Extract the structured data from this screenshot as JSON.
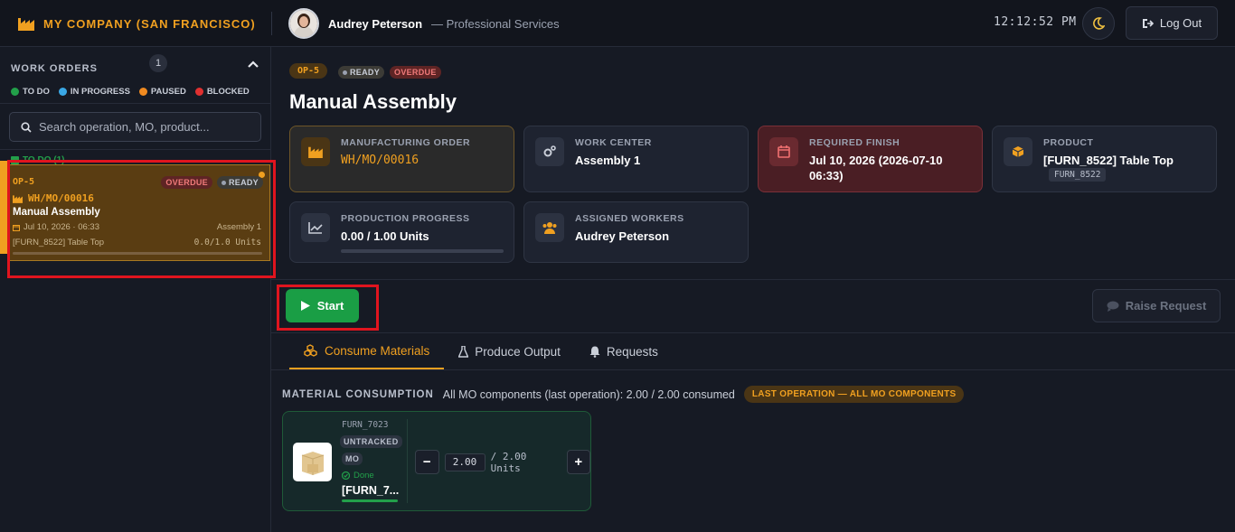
{
  "header": {
    "company": "MY COMPANY (SAN FRANCISCO)",
    "user_name": "Audrey Peterson",
    "user_dept": "— Professional Services",
    "clock": "12:12:52 PM",
    "logout_label": "Log Out"
  },
  "sidebar": {
    "title": "WORK ORDERS",
    "count": "1",
    "legend": [
      {
        "label": "TO DO",
        "color": "#22a04a"
      },
      {
        "label": "IN PROGRESS",
        "color": "#3aa8e6"
      },
      {
        "label": "PAUSED",
        "color": "#f08a20"
      },
      {
        "label": "BLOCKED",
        "color": "#e03030"
      }
    ],
    "search_placeholder": "Search operation, MO, product...",
    "group_label": "TO DO (1)",
    "card": {
      "op": "OP-5",
      "overdue": "OVERDUE",
      "ready": "READY",
      "mo": "WH/MO/00016",
      "name": "Manual Assembly",
      "date": "Jul 10, 2026 · 06:33",
      "center": "Assembly 1",
      "product": "[FURN_8522] Table Top",
      "qty": "0.0/1.0 Units"
    }
  },
  "main": {
    "op": "OP-5",
    "ready": "READY",
    "overdue": "OVERDUE",
    "title": "Manual Assembly",
    "cards": {
      "mo_label": "MANUFACTURING ORDER",
      "mo_value": "WH/MO/00016",
      "wc_label": "WORK CENTER",
      "wc_value": "Assembly 1",
      "finish_label": "REQUIRED FINISH",
      "finish_value": "Jul 10, 2026 (2026-07-10 06:33)",
      "product_label": "PRODUCT",
      "product_value": "[FURN_8522] Table Top",
      "product_sku": "FURN_8522",
      "progress_label": "PRODUCTION PROGRESS",
      "progress_value": "0.00 / 1.00 Units",
      "progress_fraction": 0,
      "workers_label": "ASSIGNED WORKERS",
      "workers_value": "Audrey Peterson"
    },
    "start_label": "Start",
    "raise_label": "Raise Request",
    "tabs": [
      {
        "label": "Consume Materials"
      },
      {
        "label": "Produce Output"
      },
      {
        "label": "Requests"
      }
    ],
    "materials": {
      "title": "MATERIAL CONSUMPTION",
      "summary": "All MO components (last operation): 2.00 / 2.00 consumed",
      "badge": "LAST OPERATION — ALL MO COMPONENTS",
      "item": {
        "code": "FURN_7023",
        "tag1": "UNTRACKED",
        "tag2": "MO",
        "status": "Done",
        "name": "[FURN_7...",
        "qty": "2.00",
        "total": "/ 2.00 Units"
      }
    }
  }
}
